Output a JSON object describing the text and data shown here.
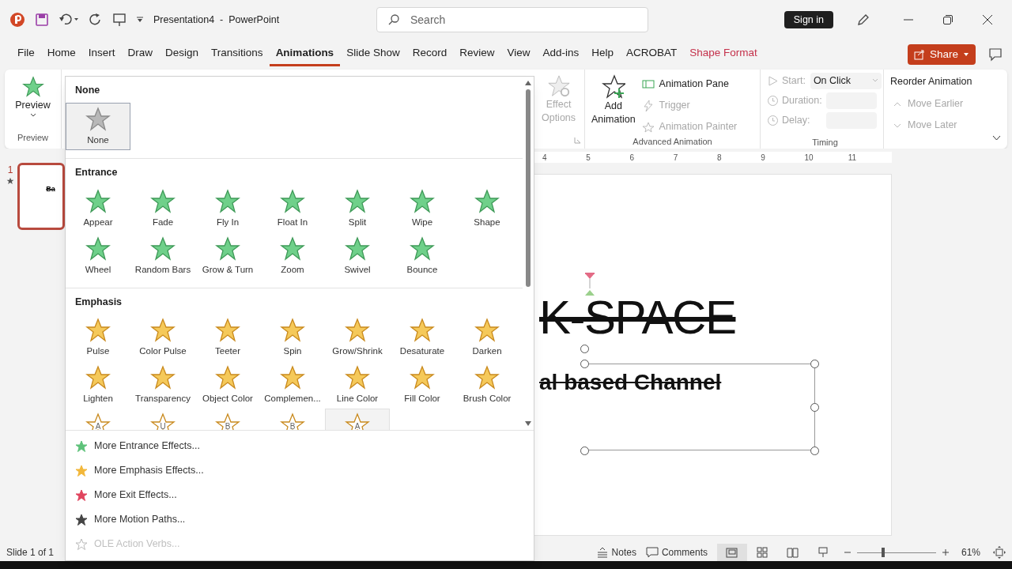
{
  "title_bar": {
    "title": "Presentation4  -  PowerPoint",
    "search_placeholder": "Search",
    "sign_in": "Sign in"
  },
  "menu_tabs": [
    {
      "label": "File",
      "selected": false,
      "kind": "normal"
    },
    {
      "label": "Home",
      "selected": false,
      "kind": "normal"
    },
    {
      "label": "Insert",
      "selected": false,
      "kind": "normal"
    },
    {
      "label": "Draw",
      "selected": false,
      "kind": "normal"
    },
    {
      "label": "Design",
      "selected": false,
      "kind": "normal"
    },
    {
      "label": "Transitions",
      "selected": false,
      "kind": "normal"
    },
    {
      "label": "Animations",
      "selected": true,
      "kind": "normal"
    },
    {
      "label": "Slide Show",
      "selected": false,
      "kind": "normal"
    },
    {
      "label": "Record",
      "selected": false,
      "kind": "normal"
    },
    {
      "label": "Review",
      "selected": false,
      "kind": "normal"
    },
    {
      "label": "View",
      "selected": false,
      "kind": "normal"
    },
    {
      "label": "Add-ins",
      "selected": false,
      "kind": "normal"
    },
    {
      "label": "Help",
      "selected": false,
      "kind": "normal"
    },
    {
      "label": "ACROBAT",
      "selected": false,
      "kind": "normal"
    },
    {
      "label": "Shape Format",
      "selected": false,
      "kind": "contextual"
    }
  ],
  "share": "Share",
  "ribbon": {
    "preview": {
      "label": "Preview",
      "group": "Preview"
    },
    "effect_options": {
      "lines": [
        "Effect",
        "Options"
      ],
      "disabled": true
    },
    "advanced_animation": {
      "add_animation": [
        "Add",
        "Animation"
      ],
      "items": [
        {
          "label": "Animation Pane",
          "disabled": false
        },
        {
          "label": "Trigger",
          "disabled": true
        },
        {
          "label": "Animation Painter",
          "disabled": true
        }
      ],
      "group": "Advanced Animation"
    },
    "timing": {
      "start_label": "Start:",
      "start_value": "On Click",
      "duration_label": "Duration:",
      "delay_label": "Delay:",
      "disabled": true,
      "group": "Timing"
    },
    "reorder": {
      "title": "Reorder Animation",
      "items": [
        {
          "label": "Move Earlier",
          "disabled": true
        },
        {
          "label": "Move Later",
          "disabled": true
        }
      ]
    }
  },
  "ruler": [
    "4",
    "5",
    "6",
    "7",
    "8",
    "9",
    "10",
    "11"
  ],
  "slide": {
    "number": "1",
    "thumbnail_text": "Ba",
    "title": "K-SPACE",
    "subtitle": "al based Channel"
  },
  "gallery": {
    "sections": [
      {
        "title": "None",
        "kind": "none",
        "effects": [
          {
            "label": "None",
            "selected": true
          }
        ]
      },
      {
        "title": "Entrance",
        "kind": "entrance",
        "effects": [
          {
            "label": "Appear",
            "selected": false
          },
          {
            "label": "Fade",
            "selected": false
          },
          {
            "label": "Fly In",
            "selected": false
          },
          {
            "label": "Float In",
            "selected": false
          },
          {
            "label": "Split",
            "selected": false
          },
          {
            "label": "Wipe",
            "selected": false
          },
          {
            "label": "Shape",
            "selected": false
          },
          {
            "label": "Wheel",
            "selected": false
          },
          {
            "label": "Random Bars",
            "selected": false
          },
          {
            "label": "Grow & Turn",
            "selected": false
          },
          {
            "label": "Zoom",
            "selected": false
          },
          {
            "label": "Swivel",
            "selected": false
          },
          {
            "label": "Bounce",
            "selected": false
          }
        ]
      },
      {
        "title": "Emphasis",
        "kind": "emphasis",
        "effects": [
          {
            "label": "Pulse",
            "selected": false
          },
          {
            "label": "Color Pulse",
            "selected": false
          },
          {
            "label": "Teeter",
            "selected": false
          },
          {
            "label": "Spin",
            "selected": false
          },
          {
            "label": "Grow/Shrink",
            "selected": false
          },
          {
            "label": "Desaturate",
            "selected": false
          },
          {
            "label": "Darken",
            "selected": false
          },
          {
            "label": "Lighten",
            "selected": false
          },
          {
            "label": "Transparency",
            "selected": false
          },
          {
            "label": "Object Color",
            "selected": false
          },
          {
            "label": "Complemen...",
            "selected": false
          },
          {
            "label": "Line Color",
            "selected": false
          },
          {
            "label": "Fill Color",
            "selected": false
          },
          {
            "label": "Brush Color",
            "selected": false
          },
          {
            "glyph": "A",
            "selected": false
          },
          {
            "glyph": "U",
            "selected": false
          },
          {
            "glyph": "B",
            "selected": false
          },
          {
            "glyph": "B",
            "selected": false
          },
          {
            "glyph": "A",
            "selected": true
          }
        ]
      }
    ],
    "menu": [
      {
        "label": "More Entrance Effects...",
        "color": "#5ec27a",
        "disabled": false
      },
      {
        "label": "More Emphasis Effects...",
        "color": "#f2b73a",
        "disabled": false
      },
      {
        "label": "More Exit Effects...",
        "color": "#e0455e",
        "disabled": false
      },
      {
        "label": "More Motion Paths...",
        "color": "#444444",
        "disabled": false
      },
      {
        "label": "OLE Action Verbs...",
        "color": "#bbbbbb",
        "disabled": true
      }
    ]
  },
  "status_bar": {
    "slide": "Slide 1 of 1",
    "notes": "Notes",
    "comments": "Comments",
    "zoom": "61%",
    "zoom_slider": {
      "level": 0.33
    }
  }
}
